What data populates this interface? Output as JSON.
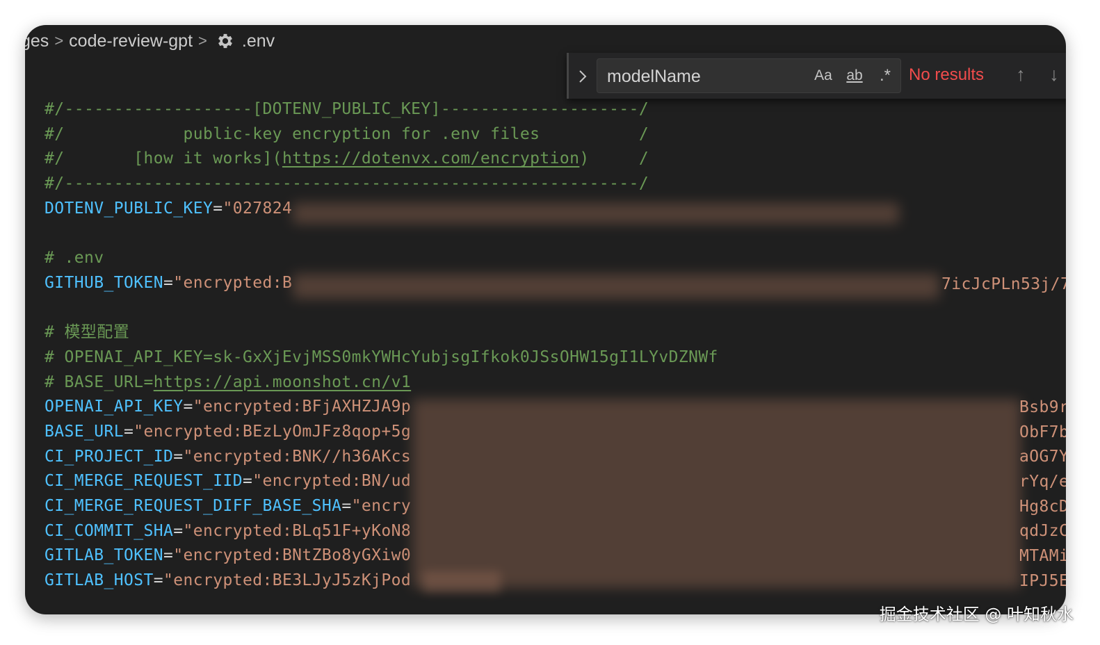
{
  "breadcrumb": {
    "items": [
      "ges",
      "code-review-gpt",
      ".env"
    ],
    "separator": ">",
    "file_icon": "gear-icon"
  },
  "find_widget": {
    "toggle_icon": "chevron-right-icon",
    "query": "modelName",
    "match_case_label": "Aa",
    "match_whole_word_label": "ab",
    "regex_label": ".*",
    "status": "No results",
    "prev_icon": "arrow-up-icon",
    "next_icon": "arrow-down-icon",
    "prev_glyph": "↑",
    "next_glyph": "↓",
    "status_color": "#f14c4c"
  },
  "editor": {
    "header": {
      "l1": "#/-------------------[DOTENV_PUBLIC_KEY]--------------------/",
      "l2": "#/            public-key encryption for .env files          /",
      "l3_pre": "#/       [how it works](",
      "l3_link": "https://dotenvx.com/encryption",
      "l3_post": ")     /",
      "l4": "#/----------------------------------------------------------/"
    },
    "public_key": {
      "key": "DOTENV_PUBLIC_KEY",
      "value": "\"027824"
    },
    "env_comment": "# .env",
    "github_token": {
      "key": "GITHUB_TOKEN",
      "value": "\"encrypted:B",
      "tail": "7icJcPLn53j/7"
    },
    "model_comment": "# 模型配置",
    "openai_comment": "# OPENAI_API_KEY=sk-GxXjEvjMSS0mkYWHcYubjsgIfkok0JSsOHW15gI1LYvDZNWf",
    "base_url_comment_pre": "# BASE_URL=",
    "base_url_comment_link": "https://api.moonshot.cn/v1",
    "vars": [
      {
        "key": "OPENAI_API_KEY",
        "value": "\"encrypted:BFjAXHZJA9p",
        "tail": "Bsb9r"
      },
      {
        "key": "BASE_URL",
        "value": "\"encrypted:BEzLyOmJFz8qop+5g",
        "tail": "ObF7b"
      },
      {
        "key": "CI_PROJECT_ID",
        "value": "\"encrypted:BNK//h36AKcs",
        "tail": "aOG7Y"
      },
      {
        "key": "CI_MERGE_REQUEST_IID",
        "value": "\"encrypted:BN/ud",
        "tail": "rYq/e"
      },
      {
        "key": "CI_MERGE_REQUEST_DIFF_BASE_SHA",
        "value": "\"encry",
        "tail": "Hg8cD"
      },
      {
        "key": "CI_COMMIT_SHA",
        "value": "\"encrypted:BLq51F+yKoN8",
        "tail": "qdJzC"
      },
      {
        "key": "GITLAB_TOKEN",
        "value": "\"encrypted:BNtZBo8yGXiw0",
        "tail": "MTAMi"
      },
      {
        "key": "GITLAB_HOST",
        "value": "\"encrypted:BE3LJyJ5zKjPod",
        "tail": "IPJ5E"
      }
    ]
  },
  "watermark": "掘金技术社区 @ 叶知秋水",
  "colors": {
    "editor_bg": "#1f1f1f",
    "comment": "#6a9955",
    "key": "#4fc1ff",
    "string": "#ce9178",
    "redaction": "#7d5a49"
  }
}
